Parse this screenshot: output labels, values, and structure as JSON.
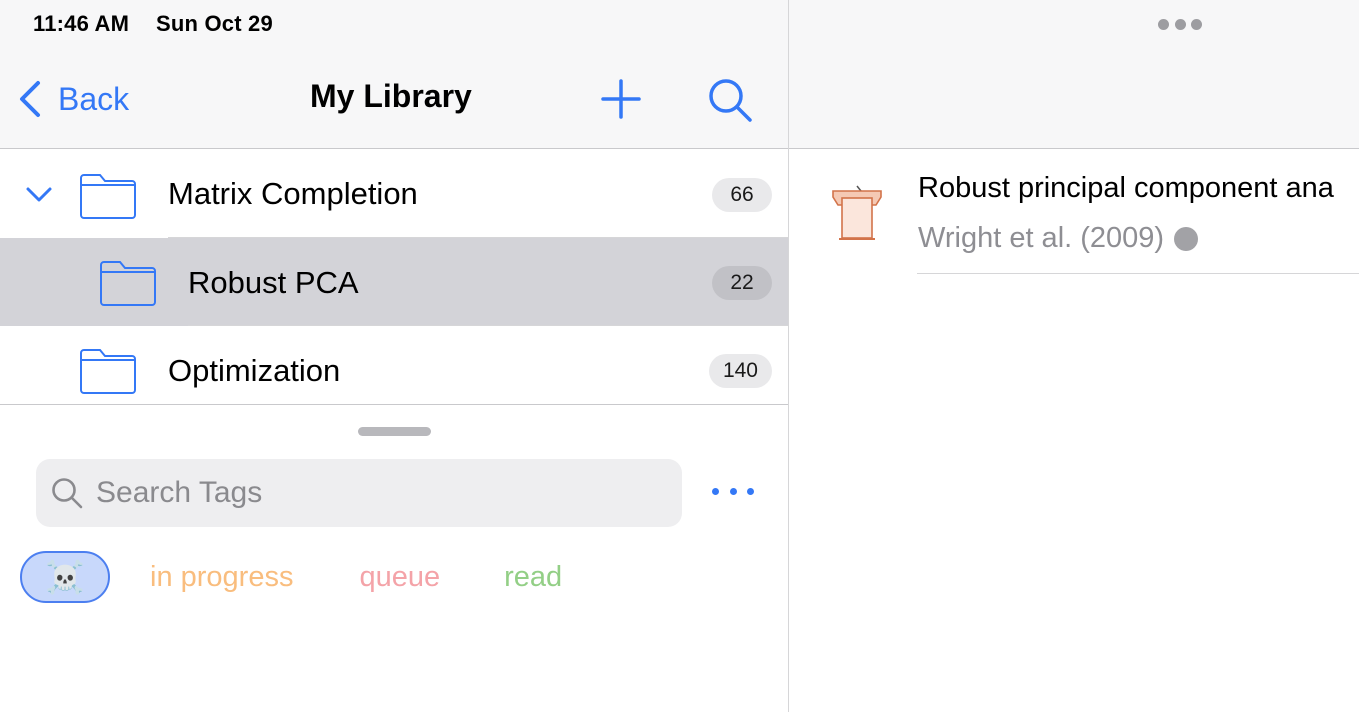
{
  "status_bar": {
    "time": "11:46 AM",
    "date": "Sun Oct 29"
  },
  "nav": {
    "back_label": "Back",
    "title": "My Library",
    "icons": [
      "chevron-left-icon",
      "plus-icon",
      "search-icon"
    ]
  },
  "collections": [
    {
      "name": "Matrix Completion",
      "count": "66",
      "expanded": true,
      "selected": false
    },
    {
      "name": "Robust PCA",
      "count": "22",
      "expanded": false,
      "selected": true
    },
    {
      "name": "Optimization",
      "count": "140",
      "expanded": false,
      "selected": false
    }
  ],
  "tag_panel": {
    "search_placeholder": "Search Tags",
    "tags": [
      {
        "label": "☠️",
        "color": "#4c7ff0",
        "selected": true
      },
      {
        "label": "in progress",
        "color": "#f9bd7e"
      },
      {
        "label": "queue",
        "color": "#f4a3a8"
      },
      {
        "label": "read",
        "color": "#93cf86"
      }
    ]
  },
  "items": [
    {
      "title": "Robust principal component ana",
      "meta": "Wright et al. (2009)",
      "icon": "presentation-podium-icon",
      "icon_color": "#d2734a"
    }
  ],
  "colors": {
    "accent": "#3478f6",
    "selected_row": "#d3d3d8"
  }
}
